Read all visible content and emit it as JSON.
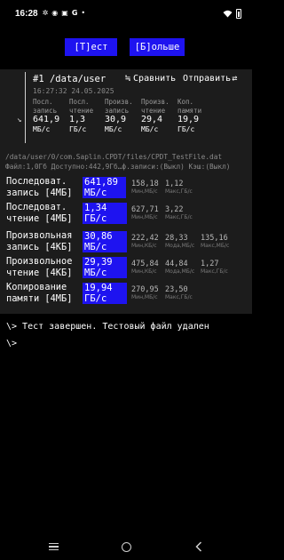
{
  "status_bar": {
    "time": "16:28",
    "icons": [
      "settings-icon",
      "discord-icon",
      "phone-icon",
      "google-icon",
      "dot-icon"
    ],
    "icon_glyphs": [
      "✲",
      "◉",
      "▣",
      "G",
      "•"
    ],
    "right_icons": [
      "wifi-icon",
      "battery-icon"
    ]
  },
  "buttons": {
    "test": "[Т]ест",
    "more": "[Б]ольше"
  },
  "run": {
    "title": "#1 /data/user",
    "compare_icon": "≒",
    "compare_label": "Сравнить",
    "share_label": "Отправить",
    "share_icon": "⇄",
    "timestamp": "16:27:32 24.05.2025",
    "collapse_icon": "↘",
    "summary": [
      {
        "label1": "Посл.",
        "label2": "запись",
        "value": "641,9",
        "unit": "МБ/с"
      },
      {
        "label1": "Посл.",
        "label2": "чтение",
        "value": "1,3",
        "unit": "ГБ/с"
      },
      {
        "label1": "Произв.",
        "label2": "запись",
        "value": "30,9",
        "unit": "МБ/с"
      },
      {
        "label1": "Произв.",
        "label2": "чтение",
        "value": "29,4",
        "unit": "МБ/с"
      },
      {
        "label1": "Коп.",
        "label2": "памяти",
        "value": "19,9",
        "unit": "ГБ/с"
      }
    ],
    "path": "/data/user/0/com.Saplin.CPDT/files/CPDT_TestFile.dat",
    "info": "Файл:1,0Гб Доступно:442,9Гб…ф.записи:(Выкл) Кэш:(Выкл)"
  },
  "results": [
    {
      "label1": "Последоват.",
      "label2": "запись [4МБ]",
      "value": "641,89",
      "unit": "МБ/с",
      "stats": [
        {
          "v": "158,18",
          "l": "Мин,МБ/с"
        },
        {
          "v": "1,12",
          "l": "Макс,ГБ/с"
        }
      ]
    },
    {
      "label1": "Последоват.",
      "label2": "чтение [4МБ]",
      "value": "1,34",
      "unit": "ГБ/с",
      "stats": [
        {
          "v": "627,71",
          "l": "Мин,МБ/с"
        },
        {
          "v": "3,22",
          "l": "Макс,ГБ/с"
        }
      ]
    },
    {
      "label1": "Произвольная",
      "label2": "запись [4КБ]",
      "value": "30,86",
      "unit": "МБ/с",
      "stats": [
        {
          "v": "222,42",
          "l": "Мин,КБ/с"
        },
        {
          "v": "28,33",
          "l": "Мода,МБ/с"
        },
        {
          "v": "135,16",
          "l": "Макс,МБ/с"
        }
      ]
    },
    {
      "label1": "Произвольное",
      "label2": "чтение [4КБ]",
      "value": "29,39",
      "unit": "МБ/с",
      "stats": [
        {
          "v": "475,84",
          "l": "Мин,КБ/с"
        },
        {
          "v": "44,84",
          "l": "Мода,МБ/с"
        },
        {
          "v": "1,27",
          "l": "Макс,ГБ/с"
        }
      ]
    },
    {
      "label1": "Копирование",
      "label2": "памяти [4МБ]",
      "value": "19,94",
      "unit": "ГБ/с",
      "stats": [
        {
          "v": "270,95",
          "l": "Мин,МБ/с"
        },
        {
          "v": "23,50",
          "l": "Макс,ГБ/с"
        }
      ]
    }
  ],
  "console": {
    "message": "\\> Тест завершен. Тестовый файл удален",
    "prompt": "\\>"
  },
  "nav": {
    "back_glyph": "‹"
  }
}
